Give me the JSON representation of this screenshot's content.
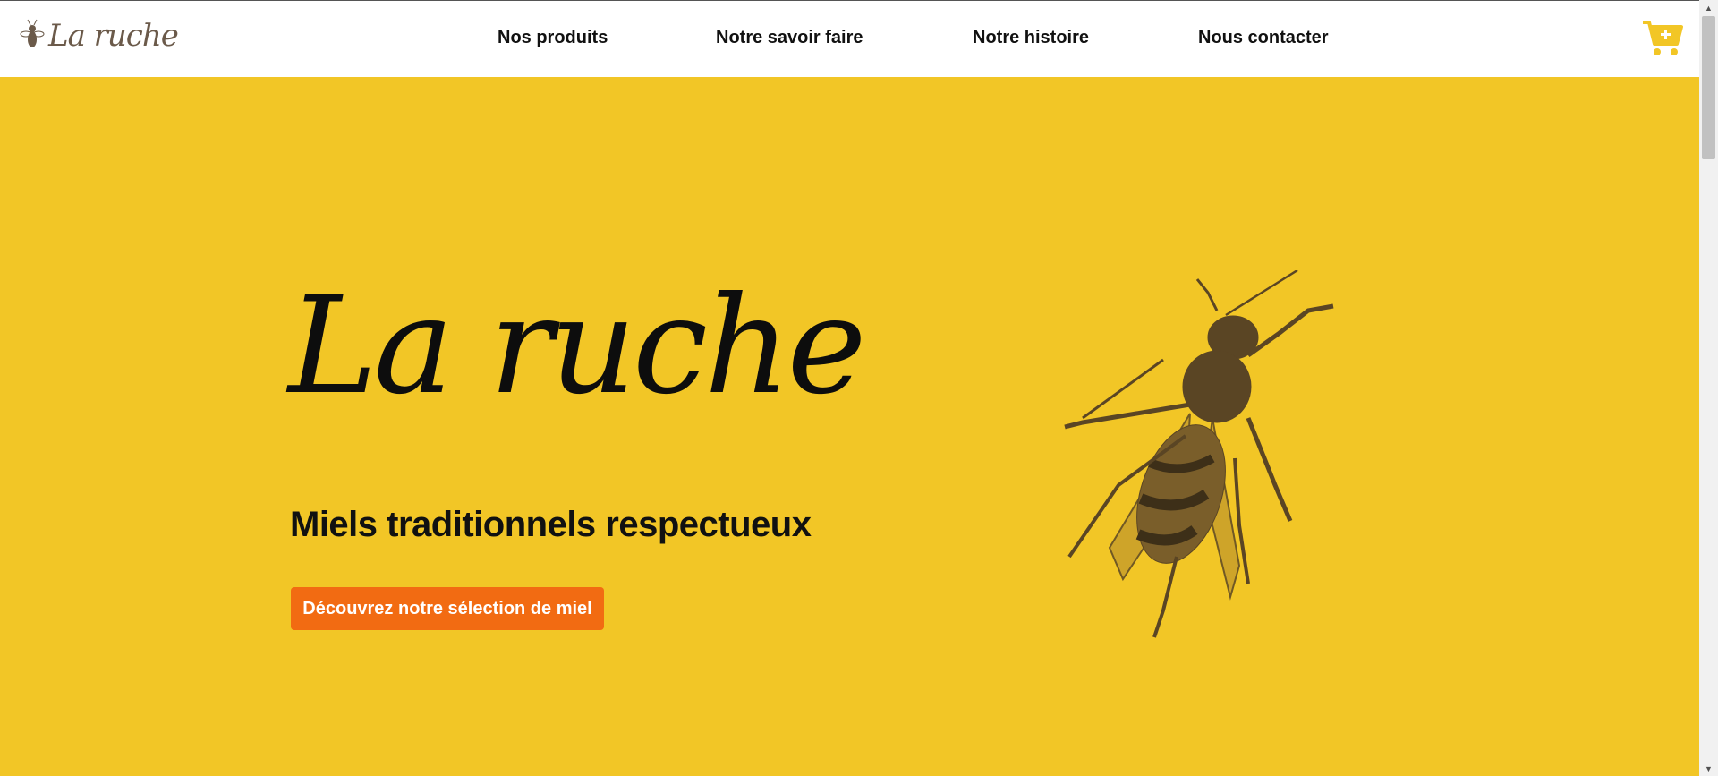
{
  "brand": {
    "logo_text": "La ruche"
  },
  "nav": {
    "items": [
      {
        "label": "Nos produits"
      },
      {
        "label": "Notre savoir faire"
      },
      {
        "label": "Notre histoire"
      },
      {
        "label": "Nous contacter"
      }
    ]
  },
  "cart": {
    "icon": "cart-plus-icon"
  },
  "hero": {
    "title": "La ruche",
    "subtitle": "Miels traditionnels respectueux",
    "cta_label": "Découvrez notre sélection de miel",
    "illustration": "bee-illustration"
  },
  "colors": {
    "hero_background": "#f2c626",
    "cta": "#f26b12",
    "cart": "#f2c626",
    "bee": "#5a4524",
    "logo": "#6b5a4a"
  }
}
